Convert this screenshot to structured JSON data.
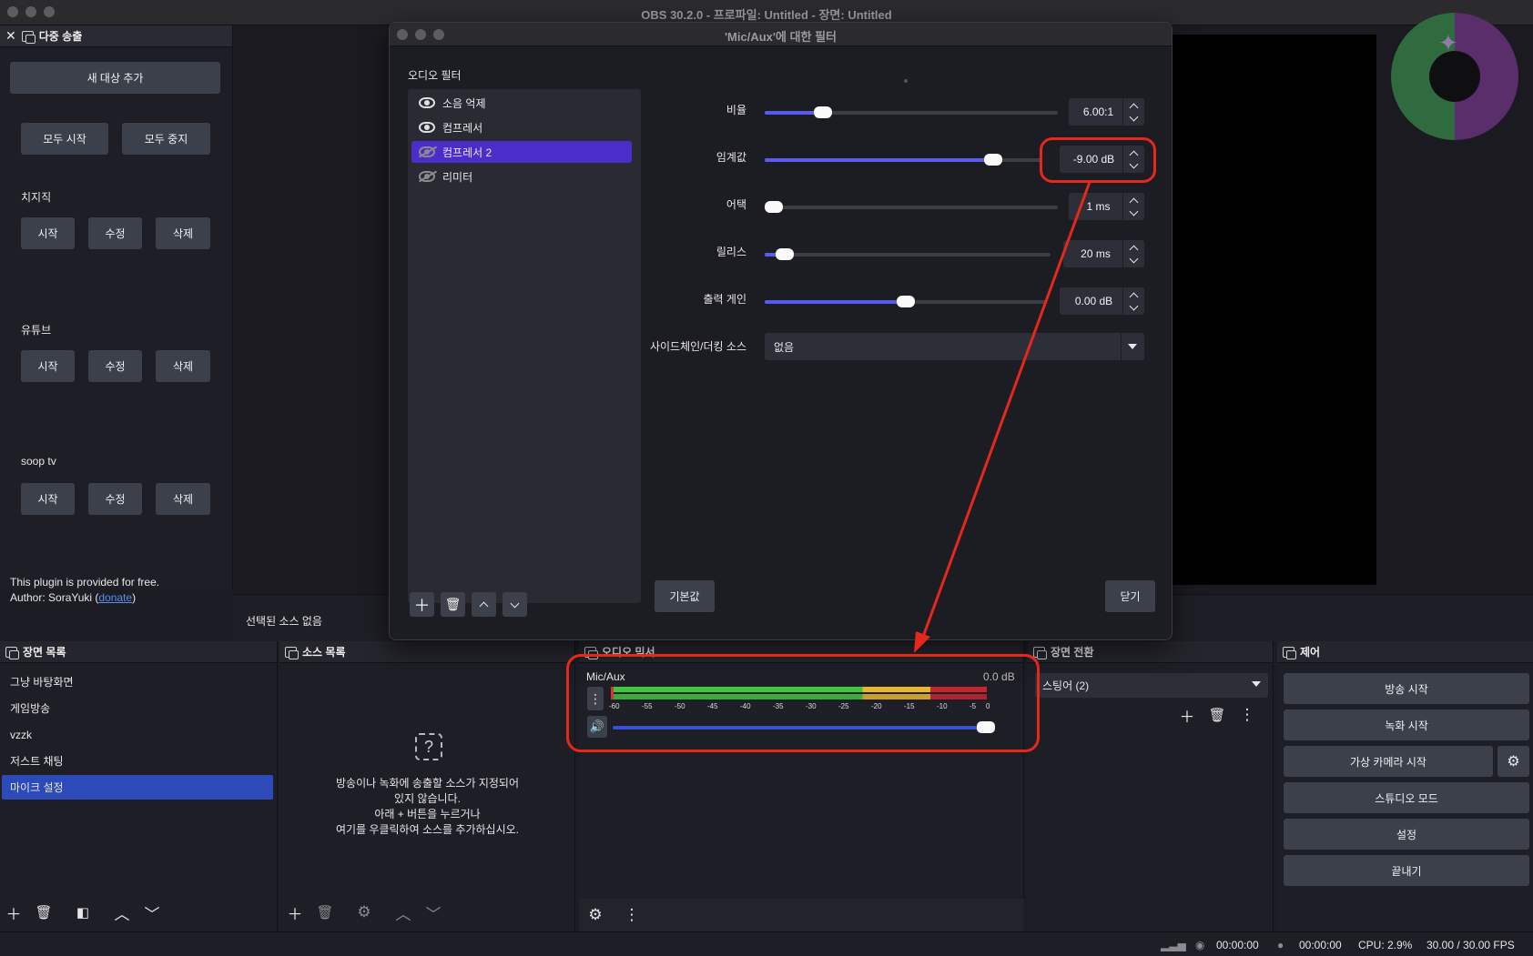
{
  "window": {
    "title": "OBS 30.2.0 - 프로파일: Untitled - 장면: Untitled"
  },
  "multi_stream": {
    "title": "다중 송출",
    "add_target": "새 대상 추가",
    "start_all": "모두 시작",
    "stop_all": "모두 중지",
    "targets": [
      {
        "name": "치지직",
        "start": "시작",
        "edit": "수정",
        "delete": "삭제"
      },
      {
        "name": "유튜브",
        "start": "시작",
        "edit": "수정",
        "delete": "삭제"
      },
      {
        "name": "soop tv",
        "start": "시작",
        "edit": "수정",
        "delete": "삭제"
      }
    ],
    "plugin_note": "This plugin is provided for free.",
    "author_prefix": "Author: SoraYuki (",
    "donate": "donate",
    "author_suffix": ")"
  },
  "no_source_selected": "선택된 소스 없음",
  "filter_dialog": {
    "title": "'Mic/Aux'에 대한 필터",
    "section": "오디오 필터",
    "filters": [
      {
        "name": "소음 억제",
        "enabled": true
      },
      {
        "name": "컴프레서",
        "enabled": true
      },
      {
        "name": "컴프레서 2",
        "enabled": false,
        "selected": true
      },
      {
        "name": "리미터",
        "enabled": false
      }
    ],
    "props": {
      "ratio": {
        "label": "비율",
        "value": "6.00:1",
        "level": 0.18
      },
      "threshold": {
        "label": "임계값",
        "value": "-9.00 dB",
        "level": 0.85
      },
      "attack": {
        "label": "어택",
        "value": "1 ms",
        "level": 0.0
      },
      "release": {
        "label": "릴리스",
        "value": "20 ms",
        "level": 0.04
      },
      "output_gain": {
        "label": "출력 게인",
        "value": "0.00 dB",
        "level": 0.5
      },
      "sidechain": {
        "label": "사이드체인/더킹 소스",
        "value": "없음"
      }
    },
    "defaults_button": "기본값",
    "close_button": "닫기"
  },
  "scenes": {
    "title": "장면 목록",
    "items": [
      "그냥 바탕화면",
      "게임방송",
      "vzzk",
      "저스트 채팅",
      "마이크 설정"
    ],
    "selected": 4
  },
  "sources": {
    "title": "소스 목록",
    "empty_lines": [
      "방송이나 녹화에 송출할 소스가 지정되어",
      "있지 않습니다.",
      "아래 + 버튼을 누르거나",
      "여기를 우클릭하여 소스를 추가하십시오."
    ]
  },
  "mixer": {
    "title": "오디오 믹서",
    "channel": "Mic/Aux",
    "db": "0.0 dB",
    "ticks": [
      "-60",
      "-55",
      "-50",
      "-45",
      "-40",
      "-35",
      "-30",
      "-25",
      "-20",
      "-15",
      "-10",
      "-5",
      "0"
    ],
    "volume_level": 1.0
  },
  "transitions": {
    "title": "장면 전환",
    "selected": "스팅어 (2)"
  },
  "controls": {
    "title": "제어",
    "start_stream": "방송 시작",
    "start_record": "녹화 시작",
    "virtual_cam": "가상 카메라 시작",
    "studio_mode": "스튜디오 모드",
    "settings": "설정",
    "exit": "끝내기"
  },
  "status": {
    "stream_time": "00:00:00",
    "record_time": "00:00:00",
    "cpu": "CPU: 2.9%",
    "fps": "30.00 / 30.00 FPS"
  },
  "colors": {
    "accent": "#4b2ec9",
    "selection": "#2c4bb8",
    "highlight": "#e6281c"
  }
}
